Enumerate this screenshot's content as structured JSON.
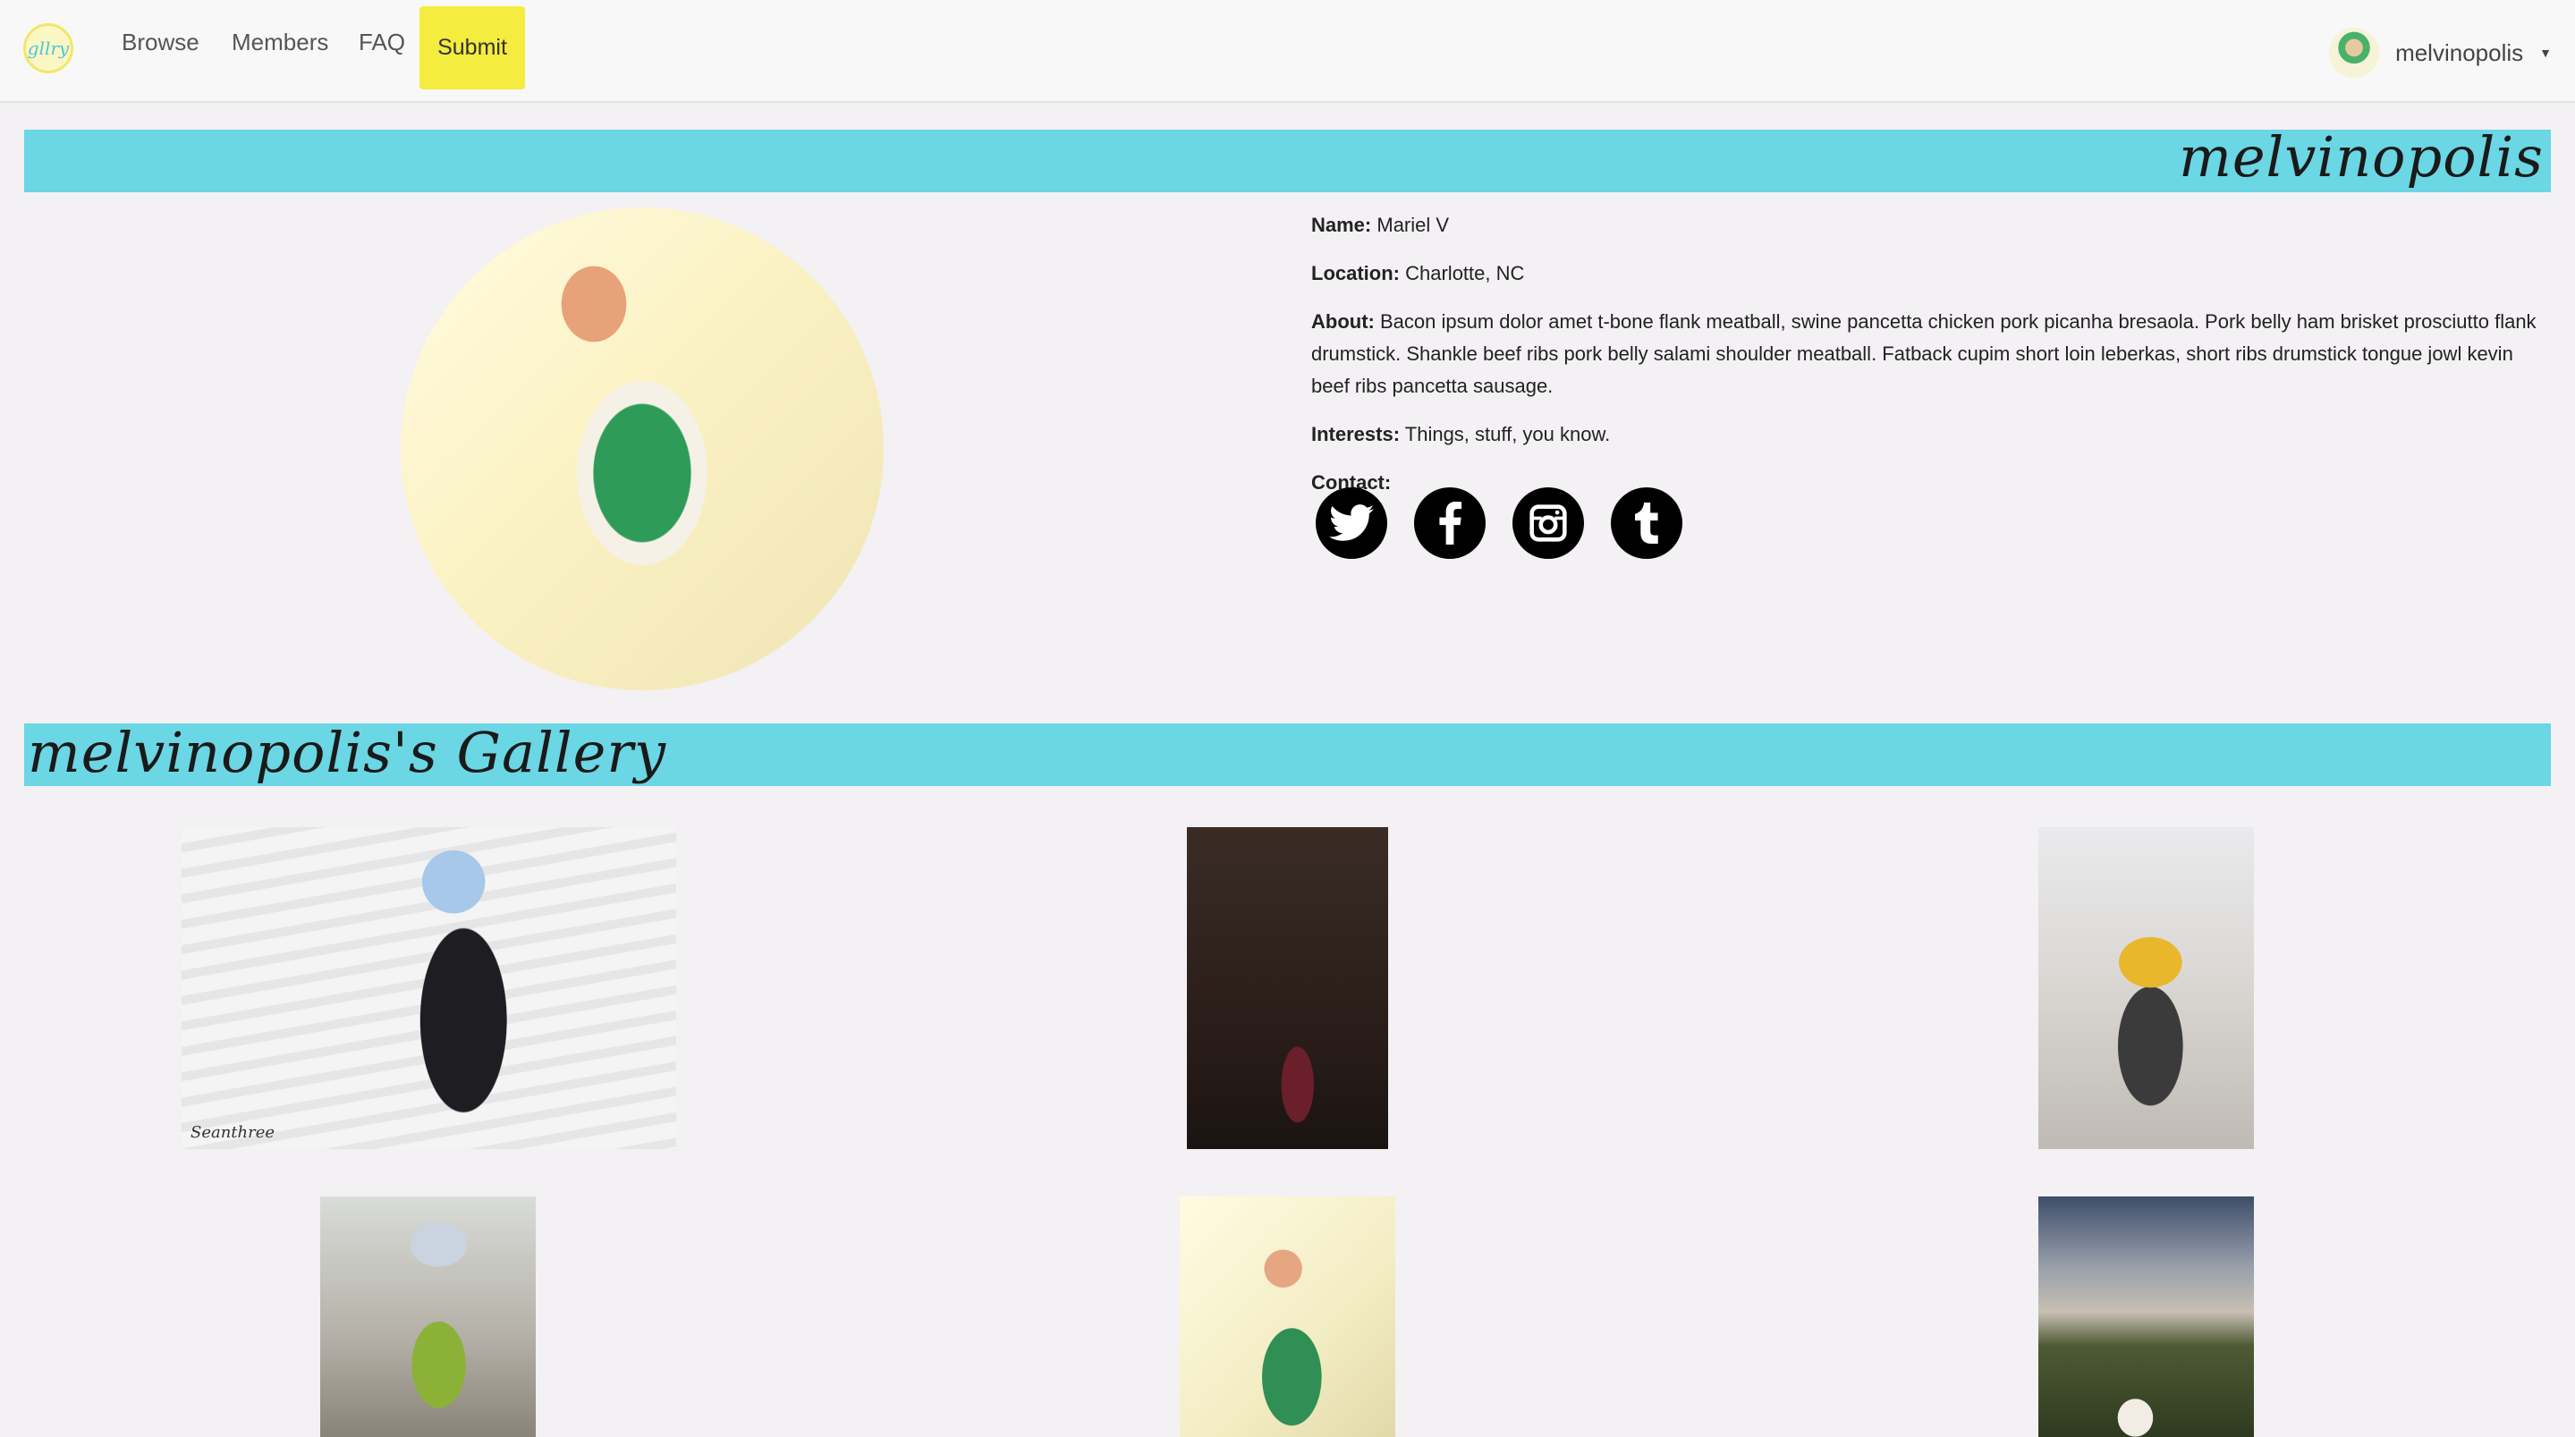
{
  "nav": {
    "logo_text": "gllry",
    "links": [
      "Browse",
      "Members",
      "FAQ"
    ],
    "submit_label": "Submit",
    "username": "melvinopolis"
  },
  "profile": {
    "banner_title": "melvinopolis",
    "name_label": "Name:",
    "name_value": "Mariel V",
    "location_label": "Location:",
    "location_value": "Charlotte, NC",
    "about_label": "About:",
    "about_value": "Bacon ipsum dolor amet t-bone flank meatball, swine pancetta chicken pork picanha bresaola. Pork belly ham brisket prosciutto flank drumstick. Shankle beef ribs pork belly salami shoulder meatball. Fatback cupim short loin leberkas, short ribs drumstick tongue jowl kevin beef ribs pancetta sausage.",
    "interests_label": "Interests:",
    "interests_value": "Things, stuff, you know.",
    "contact_label": "Contact:",
    "socials": [
      "twitter-icon",
      "facebook-icon",
      "instagram-icon",
      "tumblr-icon"
    ]
  },
  "gallery": {
    "banner_title": "melvinopolis's Gallery",
    "watermark": "Seanthree"
  },
  "colors": {
    "accent": "#6bd6e4",
    "submit": "#f4ec3e"
  }
}
